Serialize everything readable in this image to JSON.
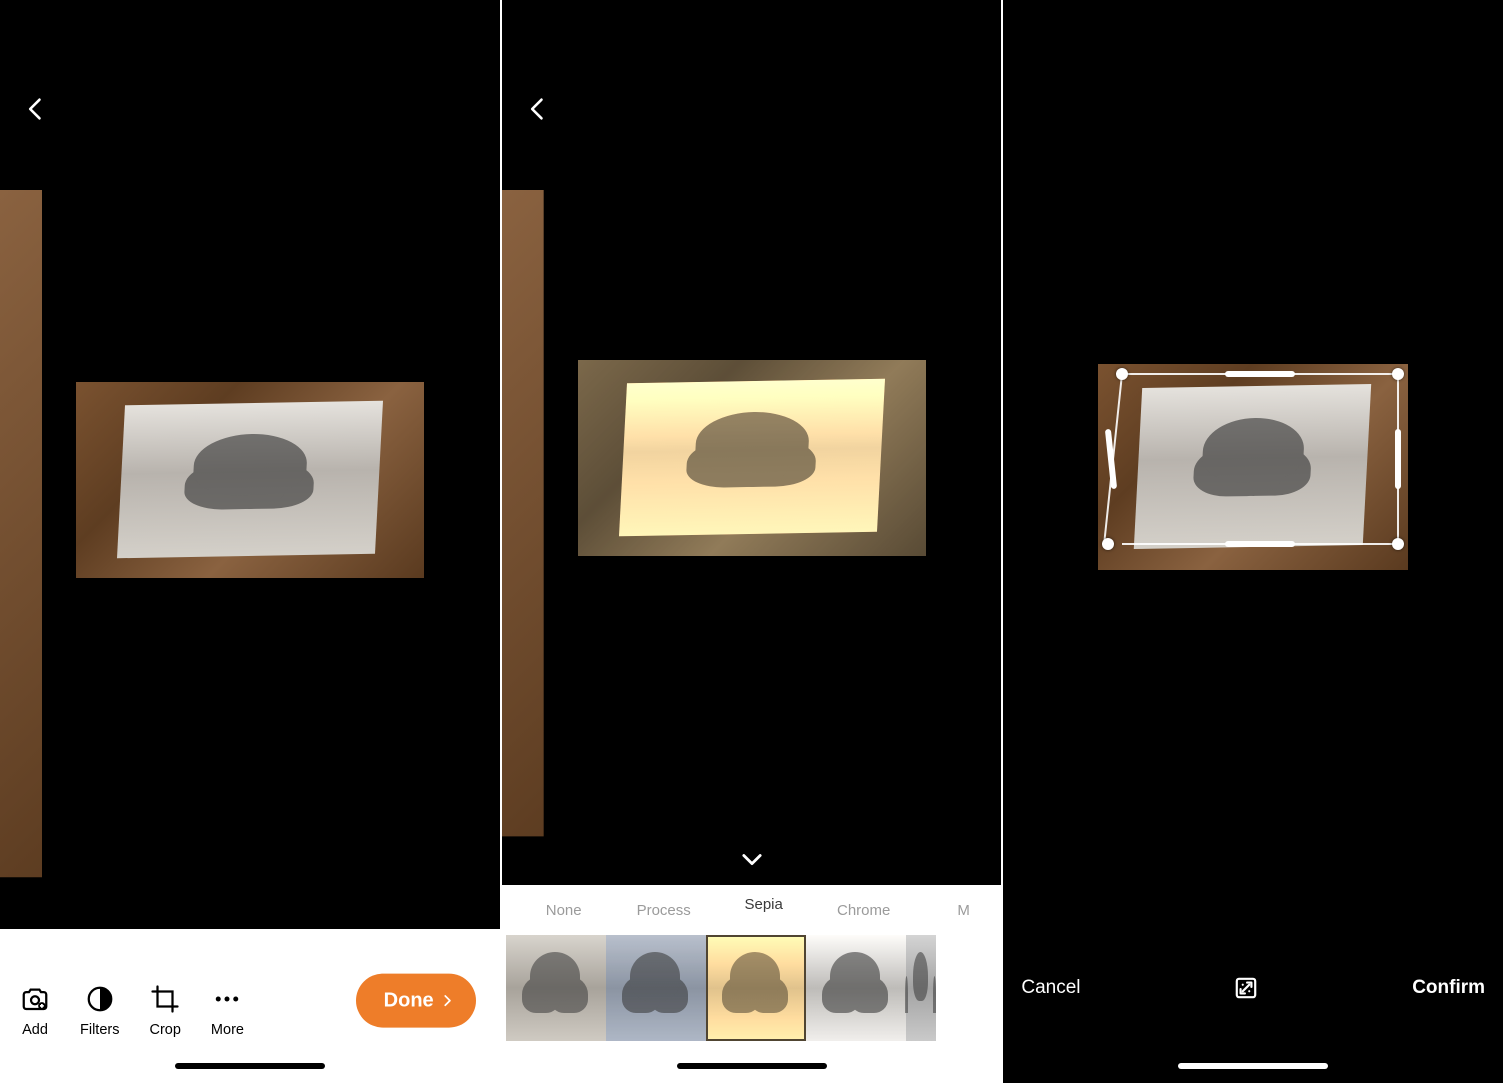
{
  "panel1": {
    "toolbar": {
      "items": [
        {
          "id": "add",
          "label": "Add"
        },
        {
          "id": "filters",
          "label": "Filters"
        },
        {
          "id": "crop",
          "label": "Crop"
        },
        {
          "id": "more",
          "label": "More"
        }
      ],
      "done_label": "Done"
    }
  },
  "panel2": {
    "filters": {
      "selected": "Sepia",
      "options": [
        {
          "id": "none",
          "label": "None"
        },
        {
          "id": "process",
          "label": "Process"
        },
        {
          "id": "sepia",
          "label": "Sepia"
        },
        {
          "id": "chrome",
          "label": "Chrome"
        },
        {
          "id": "mono",
          "label": "M"
        }
      ]
    }
  },
  "panel3": {
    "crop": {
      "cancel_label": "Cancel",
      "confirm_label": "Confirm"
    }
  },
  "colors": {
    "accent": "#ee7d29"
  }
}
